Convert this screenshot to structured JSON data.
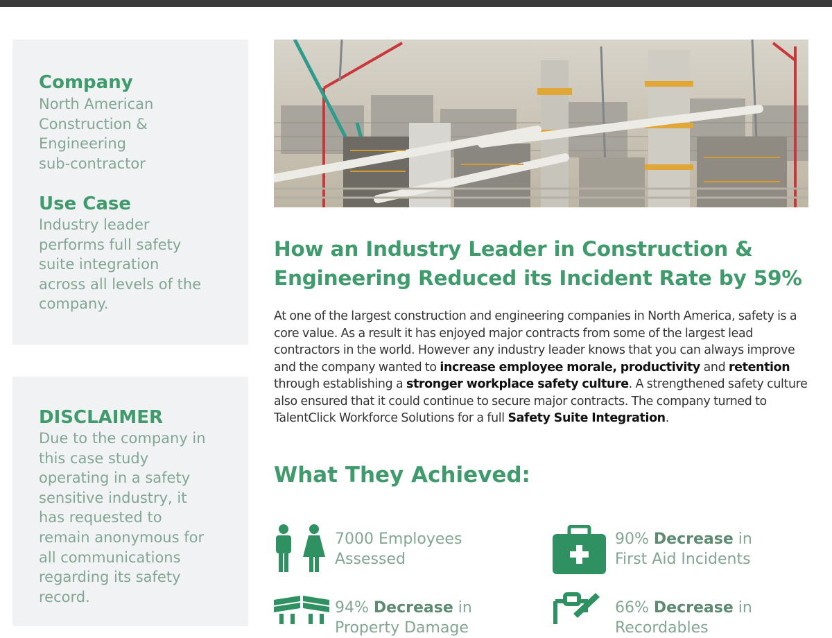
{
  "sidebar": {
    "company": {
      "heading": "Company",
      "lines": [
        "North American",
        "Construction &",
        "Engineering",
        "sub-contractor"
      ]
    },
    "use_case": {
      "heading": "Use Case",
      "lines": [
        "Industry leader",
        "performs full safety",
        "suite integration",
        "across all levels of the",
        "company."
      ]
    },
    "disclaimer": {
      "heading": "DISCLAIMER",
      "lines": [
        "Due to the company in",
        "this case study",
        "operating in a safety",
        "sensitive industry, it",
        "has requested to",
        "remain anonymous for",
        "all communications",
        "regarding its safety",
        "record."
      ]
    }
  },
  "article": {
    "title_lines": [
      "How an Industry Leader in Construction &",
      "Engineering Reduced its Incident Rate by 59%"
    ],
    "body": {
      "t1": "At one of the largest construction and engineering companies in North America, safety is a core value. As a result it has enjoyed major contracts from some of the largest lead contractors in the world. However any industry leader knows that you can always improve and the company wanted to ",
      "b1": "increase employee morale, productivity",
      "t2": " and ",
      "b2": "retention",
      "t3": " through establishing a ",
      "b3": "stronger workplace safety culture",
      "t4": ". A strengthened safety culture also ensured that it could continue to secure major contracts. The company turned to TalentClick Workforce Solutions for a full ",
      "b4": "Safety Suite Integration",
      "t5": "."
    },
    "achievements_heading": "What They Achieved:"
  },
  "stats": [
    {
      "icon": "people-icon",
      "line1": "7000 Employees",
      "line2": "Assessed"
    },
    {
      "icon": "first-aid-kit-icon",
      "line1_value": "90%",
      "line1_bold": "Decrease",
      "line1_suffix": "in",
      "line2": "First Aid Incidents"
    },
    {
      "icon": "property-icon",
      "line1_value": "94%",
      "line1_bold": "Decrease",
      "line1_suffix": "in",
      "line2": "Property Damage"
    },
    {
      "icon": "clipboard-icon",
      "line1_value": "66%",
      "line1_bold": "Decrease",
      "line1_suffix": "in",
      "line2": "Recordables"
    }
  ],
  "colors": {
    "accent_green": "#3f9a6c",
    "muted_green_text": "#82a693",
    "sidebar_bg": "#f0f2f3",
    "top_bar": "#3a3a3a"
  }
}
